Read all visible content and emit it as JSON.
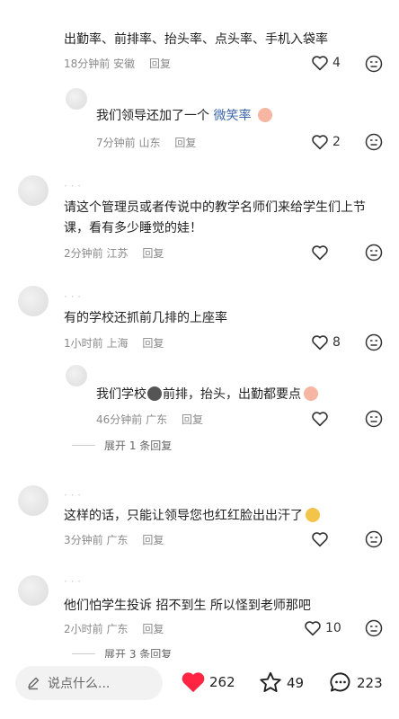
{
  "comments": [
    {
      "text": "出勤率、前排率、抬头率、点头率、手机入袋率",
      "time": "18分钟前",
      "location": "安徽",
      "reply": "回复",
      "likes": "4"
    },
    {
      "text_prefix": "我们领导还加了一个",
      "text_link": "微笑率",
      "time": "7分钟前",
      "location": "山东",
      "reply": "回复",
      "likes": "2"
    },
    {
      "text": "请这个管理员或者传说中的教学名师们来给学生们上节课，看有多少睡觉的娃！",
      "time": "2分钟前",
      "location": "江苏",
      "reply": "回复",
      "likes": ""
    },
    {
      "text": "有的学校还抓前几排的上座率",
      "time": "1小时前",
      "location": "上海",
      "reply": "回复",
      "likes": "8"
    },
    {
      "text_prefix": "我们学校",
      "text_suffix": "前排，抬头，出勤都要点",
      "time": "46分钟前",
      "location": "广东",
      "reply": "回复",
      "likes": ""
    },
    {
      "text": "这样的话，只能让领导您也红红脸出出汗了",
      "time": "3分钟前",
      "location": "广东",
      "reply": "回复",
      "likes": ""
    },
    {
      "text": "他们怕学生投诉 招不到生 所以怪到老师那吧",
      "time": "2小时前",
      "location": "广东",
      "reply": "回复",
      "likes": "10"
    }
  ],
  "expand_1": "展开 1 条回复",
  "expand_2": "展开 3 条回复",
  "bottom": {
    "placeholder": "说点什么...",
    "likes": "262",
    "favorites": "49",
    "comments": "223"
  },
  "colors": {
    "like_red": "#ff2442",
    "link_blue": "#3a63a8"
  },
  "icons": [
    "heart-icon",
    "dislike-icon",
    "pencil-icon",
    "heart-filled-icon",
    "star-icon",
    "chat-bubble-icon"
  ]
}
